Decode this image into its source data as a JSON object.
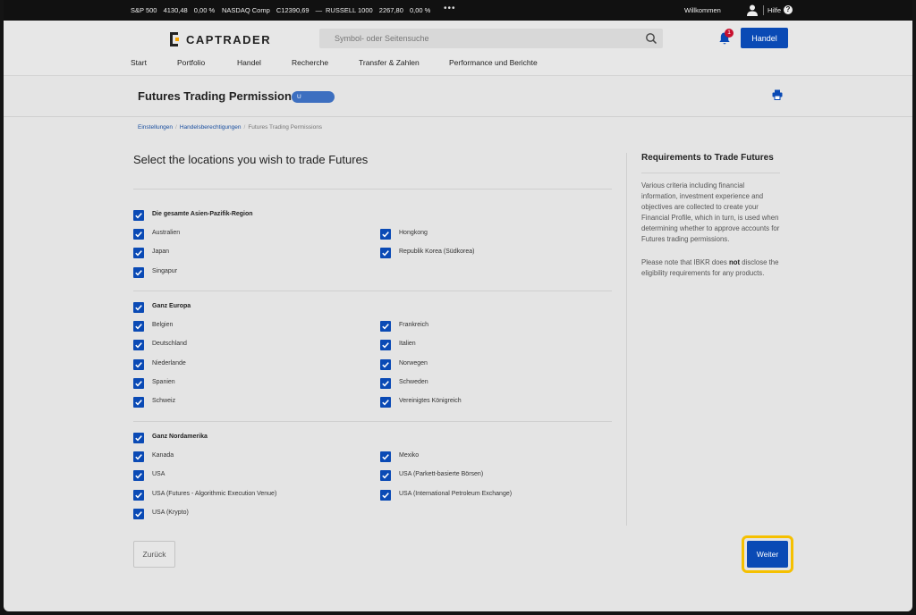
{
  "ticker": {
    "items": [
      {
        "name": "S&P 500",
        "value": "4130,48",
        "change": "0,00 %"
      },
      {
        "name": "NASDAQ Comp",
        "value": "C12390,69",
        "change": "—"
      },
      {
        "name": "RUSSELL 1000",
        "value": "2267,80",
        "change": "0,00 %"
      }
    ],
    "more": "•••",
    "welcome": "Willkommen",
    "help": "Hilfe"
  },
  "header": {
    "logo": "CAPTRADER",
    "search_placeholder": "Symbol- oder Seitensuche",
    "notification_count": "1",
    "trade_button": "Handel",
    "nav": [
      "Start",
      "Portfolio",
      "Handel",
      "Recherche",
      "Transfer & Zahlen",
      "Performance und Berichte"
    ]
  },
  "page": {
    "title": "Futures Trading Permissions",
    "account": "U"
  },
  "breadcrumb": [
    "Einstellungen",
    "Handelsberechtigungen",
    "Futures Trading Permissions"
  ],
  "main": {
    "heading": "Select the locations you wish to trade Futures",
    "regions": [
      {
        "label": "Die gesamte Asien-Pazifik-Region",
        "items": [
          "Australien",
          "Hongkong",
          "Japan",
          "Republik Korea (Südkorea)",
          "Singapur"
        ]
      },
      {
        "label": "Ganz Europa",
        "items": [
          "Belgien",
          "Frankreich",
          "Deutschland",
          "Italien",
          "Niederlande",
          "Norwegen",
          "Spanien",
          "Schweden",
          "Schweiz",
          "Vereinigtes Königreich"
        ]
      },
      {
        "label": "Ganz Nordamerika",
        "items": [
          "Kanada",
          "Mexiko",
          "USA",
          "USA (Parkett-basierte Börsen)",
          "USA (Futures - Algorithmic Execution Venue)",
          "USA (International Petroleum Exchange)",
          "USA (Krypto)"
        ]
      }
    ]
  },
  "sidebar": {
    "title": "Requirements to Trade Futures",
    "p1": "Various criteria including financial information, investment experience and objectives are collected to create your Financial Profile, which in turn, is used when determining whether to approve accounts for Futures trading permissions.",
    "p2_a": "Please note that IBKR does ",
    "p2_b": "not",
    "p2_c": " disclose the eligibility requirements for any products."
  },
  "buttons": {
    "back": "Zurück",
    "next": "Weiter"
  },
  "colors": {
    "accent": "#0a4ab5",
    "highlight": "#f5c000",
    "badge": "#c8102e"
  }
}
